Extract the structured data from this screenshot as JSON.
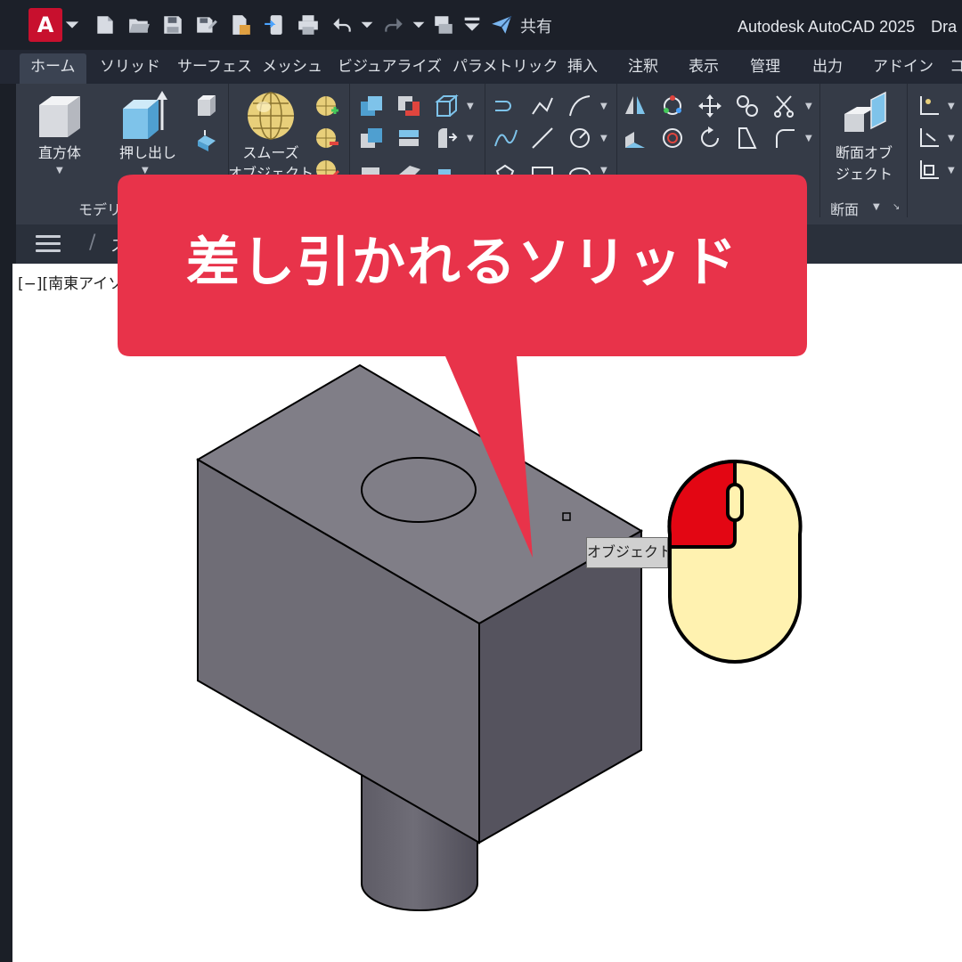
{
  "title_bar": {
    "app_letter": "A",
    "share_label": "共有",
    "window_title": "Autodesk AutoCAD 2025　Dra"
  },
  "ribbon": {
    "tabs": [
      "ホーム",
      "ソリッド",
      "サーフェス",
      "メッシュ",
      "ビジュアライズ",
      "パラメトリック",
      "挿入",
      "注釈",
      "表示",
      "管理",
      "出力",
      "アドイン",
      "コ"
    ],
    "active_tab": "ホーム",
    "buttons": {
      "box": "直方体",
      "extrude": "押し出し",
      "smooth_line1": "スムーズ",
      "smooth_line2": "オブジェクト",
      "section_line1": "断面オブ",
      "section_line2": "ジェクト"
    },
    "panel_titles": {
      "modeling": "モデリ",
      "section": "断面"
    }
  },
  "command_strip": {
    "tab_label": "スタ"
  },
  "viewport": {
    "label": "[−][南東アイソ"
  },
  "callout": {
    "text": "差し引かれるソリッド",
    "color": "#e8334a"
  },
  "tooltip": {
    "text": "オブジェクト"
  },
  "mouse": {
    "left_button_color": "#e30613",
    "body_color": "#fff2b0"
  },
  "icons": [
    "autocad-logo-icon",
    "new-icon",
    "open-icon",
    "save-icon",
    "save-as-icon",
    "open-web-icon",
    "save-web-icon",
    "plot-icon",
    "undo-icon",
    "redo-icon",
    "publish-icon",
    "share-icon",
    "box-icon",
    "extrude-icon",
    "smooth-object-icon",
    "section-plane-icon",
    "hamburger-icon",
    "mouse-left-click-icon"
  ]
}
